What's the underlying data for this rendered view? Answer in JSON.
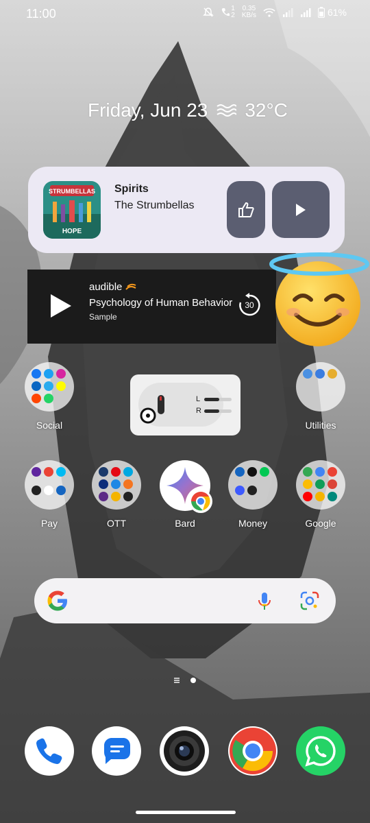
{
  "status_bar": {
    "time": "11:00",
    "network_speed_value": "0.35",
    "network_speed_unit": "KB/s",
    "sim1": "1",
    "sim2": "2",
    "battery": "61%",
    "icons": [
      "mute-icon",
      "volte-icon",
      "wifi-icon",
      "signal-icon",
      "signal-icon",
      "battery-icon"
    ]
  },
  "date_weather": {
    "date": "Friday, Jun 23",
    "temperature": "32°C",
    "weather_icon": "haze-icon"
  },
  "media_player": {
    "title": "Spirits",
    "artist": "The Strumbellas",
    "album_text": "STRUMBELLAS",
    "album_subtext": "HOPE",
    "background": "#ece9f4",
    "button_color": "#5b5e71"
  },
  "audible": {
    "logo": "audible",
    "title": "Psychology of Human Behavior",
    "subtitle": "Sample",
    "rewind": "30"
  },
  "earbuds": {
    "left": "L",
    "right": "R",
    "left_level": 0.55,
    "right_level": 0.55
  },
  "apps": {
    "social": "Social",
    "utilities": "Utilities",
    "pay": "Pay",
    "ott": "OTT",
    "bard": "Bard",
    "money": "Money",
    "google": "Google"
  },
  "folder_icons": {
    "social": [
      "facebook-icon",
      "twitter-icon",
      "instagram-icon",
      "linkedin-icon",
      "telegram-icon",
      "snapchat-icon",
      "reddit-icon",
      "whatsapp-icon"
    ],
    "utilities": [
      "files-icon",
      "drive-icon",
      "photos-icon"
    ],
    "pay": [
      "phonepe-icon",
      "gpay-icon",
      "paytm-icon",
      "bhim-icon",
      "pockets-icon",
      "bank-icon"
    ],
    "ott": [
      "sonyliv-icon",
      "netflix-icon",
      "prime-icon",
      "disney-icon",
      "play-icon",
      "crunchyroll-icon",
      "voot-icon",
      "mxplayer-icon",
      "jio-icon"
    ],
    "money": [
      "upstox-icon",
      "indmoney-icon",
      "groww-icon",
      "coin-icon",
      "kite-icon"
    ],
    "google": [
      "play-store-icon",
      "google-icon",
      "gmail-icon",
      "maps-icon",
      "drive-icon",
      "photos-icon",
      "youtube-icon",
      "keep-icon",
      "meet-icon"
    ]
  },
  "search": {
    "icons": [
      "google-g-icon",
      "mic-icon",
      "lens-icon"
    ]
  },
  "dock": [
    "phone-icon",
    "messages-icon",
    "camera-icon",
    "chrome-icon",
    "whatsapp-icon"
  ],
  "colors": {
    "google_blue": "#4285f4",
    "google_red": "#ea4335",
    "google_yellow": "#fbbc05",
    "google_green": "#34a853",
    "whatsapp": "#25d366"
  }
}
